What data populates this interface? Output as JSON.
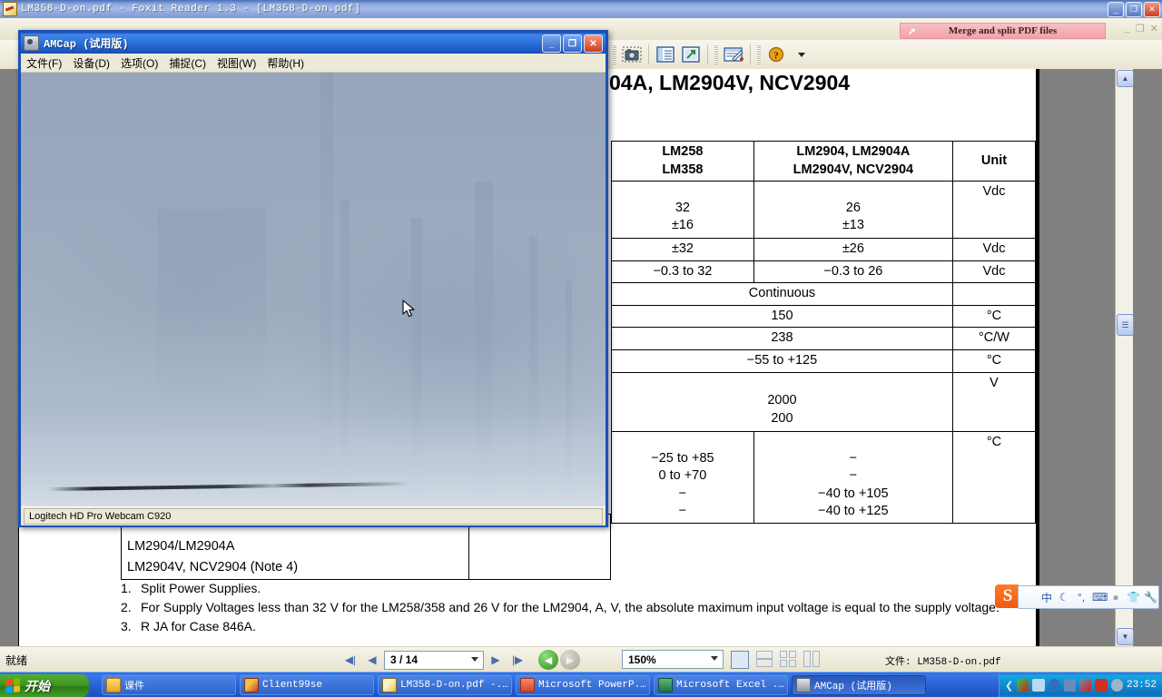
{
  "foxit": {
    "title": "LM358-D-on.pdf - Foxit Reader 1.3 - [LM358-D-on.pdf]",
    "window_buttons": {
      "minimize": "_",
      "maximize": "❐",
      "close": "✕"
    },
    "mdi_buttons": {
      "minimize": "_",
      "restore": "❐",
      "close": "✕"
    },
    "banner": {
      "label": "Merge and split PDF files",
      "arrow": "➚",
      "color": "#f0a2a8"
    },
    "toolbar_icons": [
      "snapshot-icon",
      "bookmark-panel-icon",
      "open-external-icon",
      "form-edit-icon",
      "help-icon",
      "toolbar-overflow-icon"
    ]
  },
  "document": {
    "heading": "04A, LM2904V, NCV2904",
    "table": {
      "headers": [
        "LM258\nLM358",
        "LM2904, LM2904A\nLM2904V, NCV2904",
        "Unit"
      ],
      "header_col1_line1": "LM258",
      "header_col1_line2": "LM358",
      "header_col2_line1": "LM2904, LM2904A",
      "header_col2_line2": "LM2904V, NCV2904",
      "header_col3": "Unit",
      "rows": [
        {
          "type": "split",
          "col1": "32\n±16",
          "col1_l1": "32",
          "col1_l2": "±16",
          "col2_l1": "26",
          "col2_l2": "±13",
          "unit": "Vdc"
        },
        {
          "type": "split",
          "col1_l1": "±32",
          "col2_l1": "±26",
          "unit": "Vdc"
        },
        {
          "type": "split",
          "col1_l1": "−0.3 to 32",
          "col2_l1": "−0.3 to 26",
          "unit": "Vdc"
        },
        {
          "type": "merged",
          "value": "Continuous",
          "unit": ""
        },
        {
          "type": "merged",
          "value": "150",
          "unit": "°C"
        },
        {
          "type": "merged",
          "value": "238",
          "unit": "°C/W"
        },
        {
          "type": "merged",
          "value": "−55 to +125",
          "unit": "°C"
        },
        {
          "type": "merged",
          "value_l1": "2000",
          "value_l2": "200",
          "unit": "V"
        },
        {
          "type": "split_multi",
          "col1_lines": [
            "−25 to +85",
            "0 to +70",
            "−",
            "−"
          ],
          "col2_lines": [
            "−",
            "−",
            "−40 to +105",
            "−40 to +125"
          ],
          "unit": "°C"
        }
      ]
    },
    "left_table_rows": [
      "LM2904/LM2904A",
      "LM2904V, NCV2904 (Note 4)"
    ],
    "notes": [
      {
        "num": "1.",
        "text": "Split Power Supplies."
      },
      {
        "num": "2.",
        "text": "For Supply Voltages less than 32 V for the LM258/358 and 26 V for the LM2904, A, V, the absolute maximum input voltage is equal to the supply voltage."
      },
      {
        "num": "3.",
        "text": "R JA for Case 846A."
      }
    ]
  },
  "statusbar": {
    "ready": "就绪",
    "nav": {
      "first": "◀|",
      "prev": "◀",
      "next": "▶",
      "last": "|▶"
    },
    "page": "3 / 14",
    "history": {
      "back": "◀",
      "forward": "▶"
    },
    "zoom": "150%",
    "view_modes": [
      "single-page-mode",
      "continuous-mode",
      "facing-mode",
      "continuous-facing-mode"
    ],
    "file_label": "文件: LM358-D-on.pdf"
  },
  "ime": {
    "logo": "S",
    "icons": [
      "chinese-mode-icon",
      "moon-icon",
      "punctuation-icon",
      "soft-keyboard-icon",
      "user-icon",
      "skin-icon",
      "tools-icon"
    ],
    "chinese_label": "中",
    "moon_label": "☾",
    "punct_label": "°,"
  },
  "amcap": {
    "title": "AMCap  (试用版)",
    "menus": [
      "文件(F)",
      "设备(D)",
      "选项(O)",
      "捕捉(C)",
      "视图(W)",
      "帮助(H)"
    ],
    "window_buttons": {
      "minimize": "_",
      "maximize": "❐",
      "close": "✕"
    },
    "status": "Logitech HD Pro Webcam C920",
    "video_description": "live-webcam-preview"
  },
  "taskbar": {
    "start": "开始",
    "items": [
      {
        "label": "课件",
        "icon": "folder-icon",
        "icon_color": "#f0c44a",
        "active": false
      },
      {
        "label": "Client99se",
        "icon": "client99se-icon",
        "icon_color": "#c83c28",
        "active": false
      },
      {
        "label": "LM358-D-on.pdf -...",
        "icon": "foxit-icon",
        "icon_color": "#e8c040",
        "active": false
      },
      {
        "label": "Microsoft PowerP...",
        "icon": "powerpoint-icon",
        "icon_color": "#d24726",
        "active": false
      },
      {
        "label": "Microsoft Excel ...",
        "icon": "excel-icon",
        "icon_color": "#217346",
        "active": false
      },
      {
        "label": "AMCap  (试用版)",
        "icon": "amcap-icon",
        "icon_color": "#8a96a4",
        "active": true
      }
    ],
    "tray": {
      "expand": "❮",
      "icons": [
        "network-icon",
        "volume-icon",
        "antivirus-icon",
        "monitor-icon",
        "usb-icon",
        "shield-icon",
        "sound-icon"
      ],
      "clock": "23:52"
    }
  }
}
